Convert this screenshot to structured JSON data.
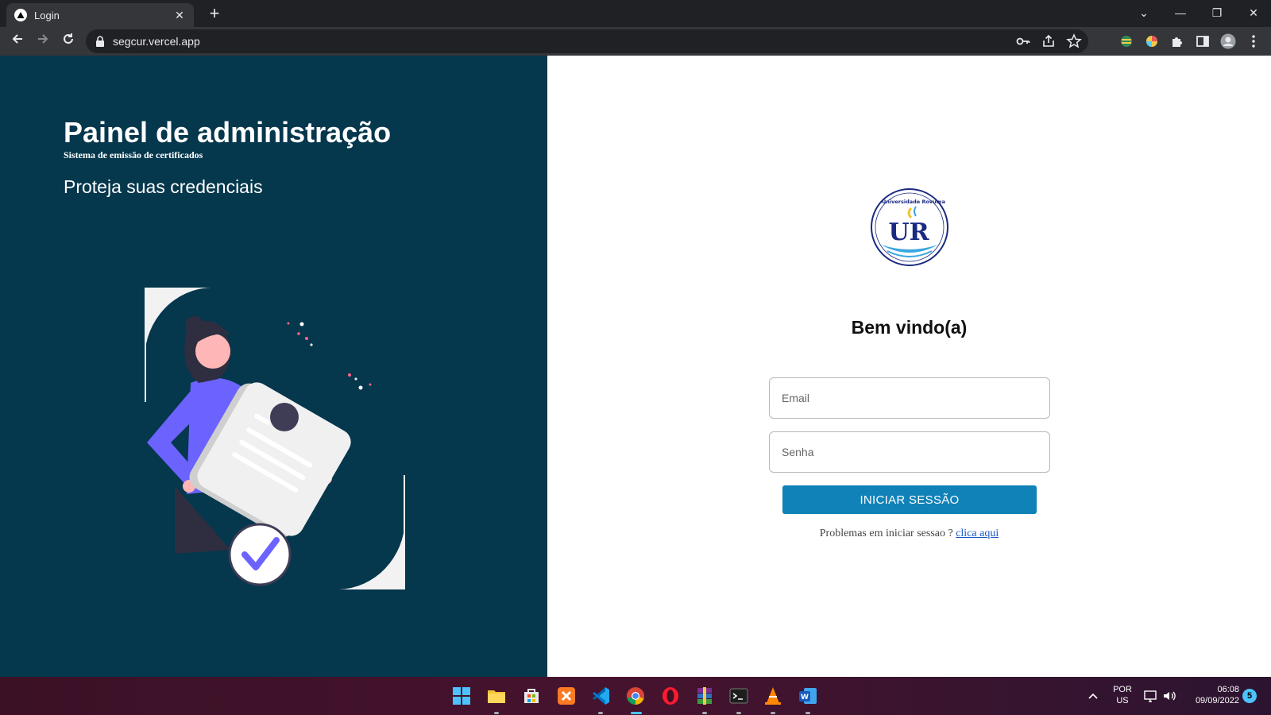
{
  "browser": {
    "tab_title": "Login",
    "tab_close": "✕",
    "new_tab": "+",
    "url": "segcur.vercel.app",
    "controls": {
      "tab_search": "⌄",
      "minimize": "—",
      "restore": "❐",
      "close": "✕"
    }
  },
  "left": {
    "title": "Painel de administração",
    "subtitle": "Sistema de emissão de certificados",
    "tagline": "Proteja suas credenciais"
  },
  "login": {
    "logo_text": "Universidade Rovuma",
    "logo_initials": "UR",
    "welcome": "Bem vindo(a)",
    "email_placeholder": "Email",
    "password_placeholder": "Senha",
    "submit_label": "INICIAR SESSÃO",
    "help_text": "Problemas em iniciar sessao ? ",
    "help_link": "clica aqui"
  },
  "taskbar": {
    "language_top": "POR",
    "language_bottom": "US",
    "time": "06:08",
    "date": "09/09/2022",
    "notifications": "5"
  },
  "colors": {
    "left_panel": "#05374d",
    "button": "#1182b8",
    "accent_purple": "#6c63ff"
  }
}
